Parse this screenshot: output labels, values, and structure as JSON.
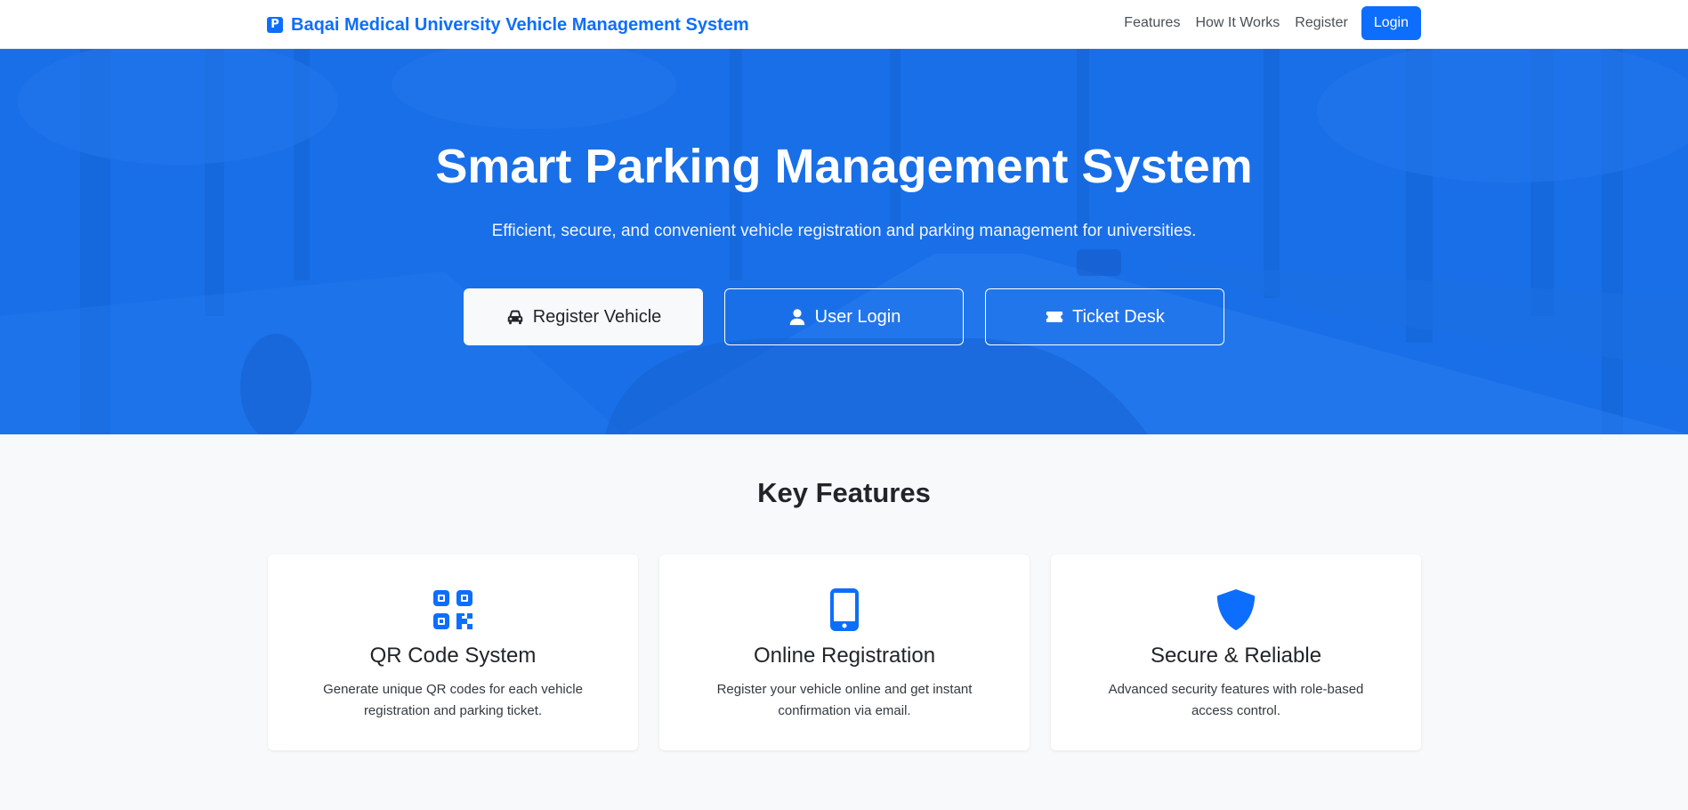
{
  "navbar": {
    "brand_icon": "P",
    "brand_title": "Baqai Medical University Vehicle Management System",
    "links": [
      "Features",
      "How It Works",
      "Register"
    ],
    "login_label": "Login"
  },
  "hero": {
    "title": "Smart Parking Management System",
    "subtitle": "Efficient, secure, and convenient vehicle registration and parking management for universities.",
    "buttons": [
      {
        "label": "Register Vehicle",
        "icon": "car-icon"
      },
      {
        "label": "User Login",
        "icon": "user-icon"
      },
      {
        "label": "Ticket Desk",
        "icon": "ticket-icon"
      }
    ]
  },
  "features": {
    "title": "Key Features",
    "cards": [
      {
        "title": "QR Code System",
        "description": "Generate unique QR codes for each vehicle registration and parking ticket.",
        "icon": "qr-code-icon"
      },
      {
        "title": "Online Registration",
        "description": "Register your vehicle online and get instant confirmation via email.",
        "icon": "phone-icon"
      },
      {
        "title": "Secure & Reliable",
        "description": "Advanced security features with role-based access control.",
        "icon": "shield-icon"
      }
    ]
  },
  "colors": {
    "primary": "#0d6efd",
    "hero_overlay": "#1a73e8",
    "page_bg": "#f8f9fa"
  }
}
